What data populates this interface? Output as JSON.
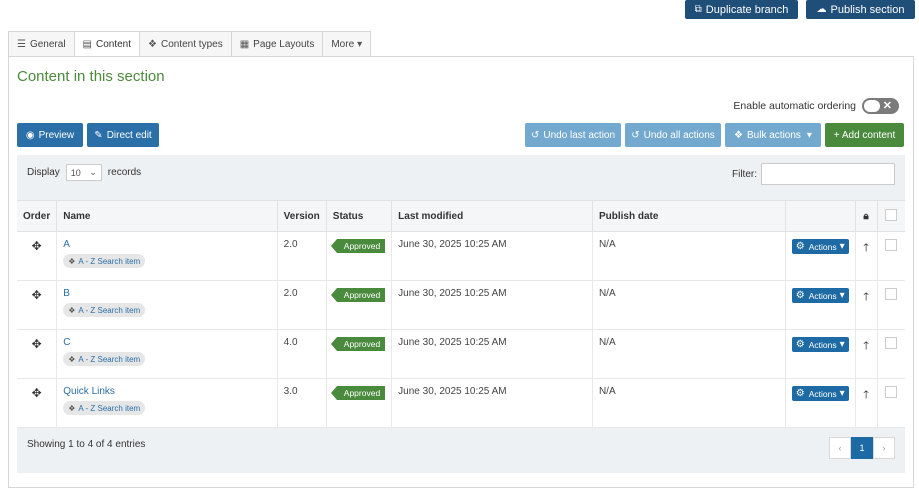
{
  "top_buttons": {
    "duplicate_label": "Duplicate branch",
    "publish_label": "Publish section"
  },
  "tabs": [
    {
      "label": "General",
      "icon": "sliders-icon"
    },
    {
      "label": "Content",
      "icon": "document-icon"
    },
    {
      "label": "Content types",
      "icon": "cubes-icon"
    },
    {
      "label": "Page Layouts",
      "icon": "layout-icon"
    },
    {
      "label": "More",
      "icon": "caret-down-icon"
    }
  ],
  "section": {
    "title": "Content in this section",
    "auto_ordering_label": "Enable automatic ordering"
  },
  "toolbar": {
    "preview": "Preview",
    "direct_edit": "Direct edit",
    "undo_last": "Undo last action",
    "undo_all": "Undo all actions",
    "bulk_actions": "Bulk actions",
    "add_content": "+ Add content"
  },
  "table_controls": {
    "display_label": "Display",
    "records_value": "10",
    "records_label": "records",
    "filter_label": "Filter:"
  },
  "columns": [
    "Order",
    "Name",
    "Version",
    "Status",
    "Last modified",
    "Publish date"
  ],
  "rows": [
    {
      "name": "A",
      "type": "A - Z Search item",
      "version": "2.0",
      "status": "Approved",
      "modified": "June 30, 2025 10:25 AM",
      "publish": "N/A",
      "actions": "Actions"
    },
    {
      "name": "B",
      "type": "A - Z Search item",
      "version": "2.0",
      "status": "Approved",
      "modified": "June 30, 2025 10:25 AM",
      "publish": "N/A",
      "actions": "Actions"
    },
    {
      "name": "C",
      "type": "A - Z Search item",
      "version": "4.0",
      "status": "Approved",
      "modified": "June 30, 2025 10:25 AM",
      "publish": "N/A",
      "actions": "Actions"
    },
    {
      "name": "Quick Links",
      "type": "A - Z Search item",
      "version": "3.0",
      "status": "Approved",
      "modified": "June 30, 2025 10:25 AM",
      "publish": "N/A",
      "actions": "Actions"
    }
  ],
  "footer": {
    "info": "Showing 1 to 4 of 4 entries",
    "current_page": "1"
  },
  "colors": {
    "navy": "#1f4e79",
    "blue": "#2a6fa8",
    "green": "#4a8a3c",
    "title_green": "#4b8b3b"
  }
}
